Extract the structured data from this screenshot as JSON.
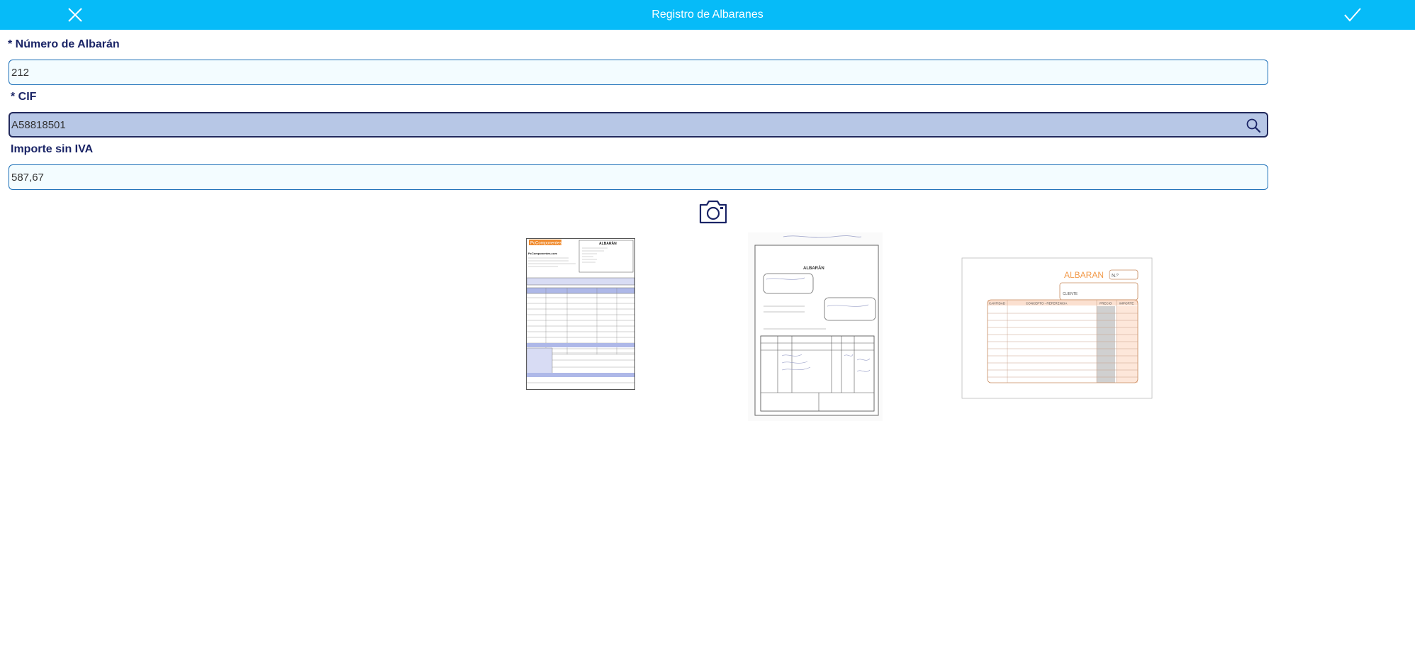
{
  "header": {
    "title": "Registro de Albaranes",
    "close_icon": "close-icon",
    "confirm_icon": "check-icon",
    "background_color": "#06bbf8"
  },
  "form": {
    "numero_albaran": {
      "label": "* Número de Albarán",
      "value": "212"
    },
    "cif": {
      "label": "* CIF",
      "value": "A58818501",
      "icon": "search-icon"
    },
    "importe": {
      "label": "Importe sin IVA",
      "value": "587,67"
    }
  },
  "camera_icon": "camera-icon",
  "documents": {
    "doc1": {
      "logo": "PcComponentes",
      "title": "ALBARÁN",
      "company": "PcComponentes.com"
    },
    "doc2": {
      "title": "ALBARÁN"
    },
    "doc3": {
      "title": "ALBARAN",
      "number_label": "N.º",
      "client_label": "CLIENTE",
      "col_cantidad": "CANTIDAD",
      "col_concepto": "CONCEPTO - REFERENCIA",
      "col_precio": "PRECIO",
      "col_importe": "IMPORTE"
    }
  },
  "colors": {
    "label": "#1a2466",
    "field_border": "#1b6fb8",
    "field_bg": "#f3fcff",
    "selected_bg": "#b7c7e6",
    "accent_orange": "#f29a4a"
  }
}
